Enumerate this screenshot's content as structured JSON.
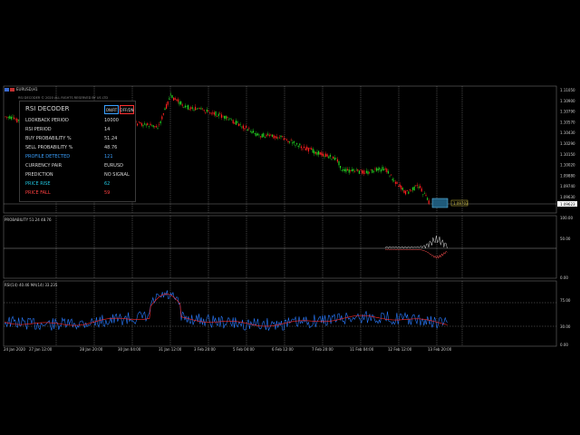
{
  "window": {
    "symbol_title": "EURUSD,H1",
    "subtitle": "RSI DECODER © 2020 ALL RIGHTS RESERVED BY US LTD"
  },
  "panel": {
    "title": "RSI DECODER",
    "btn_on": "ON/RT",
    "btn_off": "OFF/DN",
    "rows": [
      {
        "label": "LOOKBACK PERIOD",
        "value": "10000",
        "color": "#d8d8d8"
      },
      {
        "label": "RSI PERIOD",
        "value": "14",
        "color": "#d8d8d8"
      },
      {
        "label": "BUY PROBABILITY %",
        "value": "51.24",
        "color": "#d8d8d8"
      },
      {
        "label": "SELL PROBABILITY %",
        "value": "48.76",
        "color": "#d8d8d8"
      },
      {
        "label": "PROFILE DETECTED",
        "value": "121",
        "color": "#3aa0ff"
      },
      {
        "label": "CURRENCY PAIR",
        "value": "EURUSD",
        "color": "#d8d8d8"
      },
      {
        "label": "PREDICTION",
        "value": "NO SIGNAL",
        "color": "#d8d8d8"
      },
      {
        "label": "PRICE RISE",
        "value": "62",
        "color": "#22c6e0"
      },
      {
        "label": "PRICE FALL",
        "value": "59",
        "color": "#ff4040"
      }
    ]
  },
  "price_axis": [
    "1.11050",
    "1.10900",
    "1.10790",
    "1.10570",
    "1.10430",
    "1.10290",
    "1.10150",
    "1.10020",
    "1.09880",
    "1.09740",
    "1.09630"
  ],
  "current_price": "1.09623",
  "price_tag": "1.09703",
  "probability_panel": {
    "label": "PROBABILITY 51.24 48.76",
    "axis": [
      "100.00",
      "50.00",
      "0.00"
    ]
  },
  "rsi_panel": {
    "label": "RSI(14) 40.46 MA(14) 33.235",
    "axis": [
      "75.00",
      "30.00",
      "0.00"
    ]
  },
  "time_axis": [
    "24 Jan 2020",
    "27 Jan 12:00",
    "28 Jan 20:00",
    "30 Jan 04:00",
    "31 Jan 12:00",
    "3 Feb 20:00",
    "5 Feb 04:00",
    "6 Feb 12:00",
    "7 Feb 20:00",
    "11 Feb 04:00",
    "12 Feb 12:00",
    "13 Feb 20:00"
  ],
  "colors": {
    "bull": "#22d022",
    "bear": "#ff2020",
    "rsi": "#2a7bff",
    "rsi_ma": "#ff2a2a",
    "grid": "#5a5a5a"
  }
}
